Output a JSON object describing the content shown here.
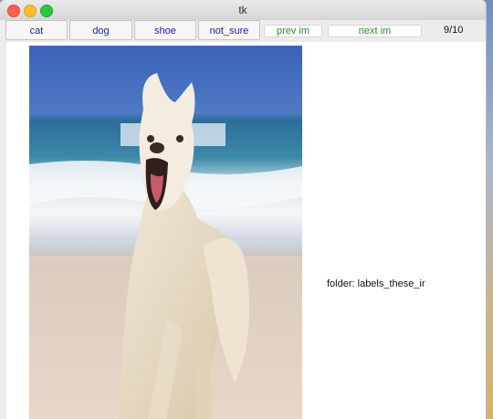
{
  "window": {
    "title": "tk"
  },
  "toolbar": {
    "buttons": [
      {
        "label": "cat"
      },
      {
        "label": "dog"
      },
      {
        "label": "shoe"
      },
      {
        "label": "not_sure"
      }
    ],
    "prev_label": "prev im",
    "next_label": "next im",
    "counter": "9/10"
  },
  "status": {
    "folder": "folder: labels_these_ir"
  },
  "image": {
    "subject": "white dog running on beach"
  }
}
